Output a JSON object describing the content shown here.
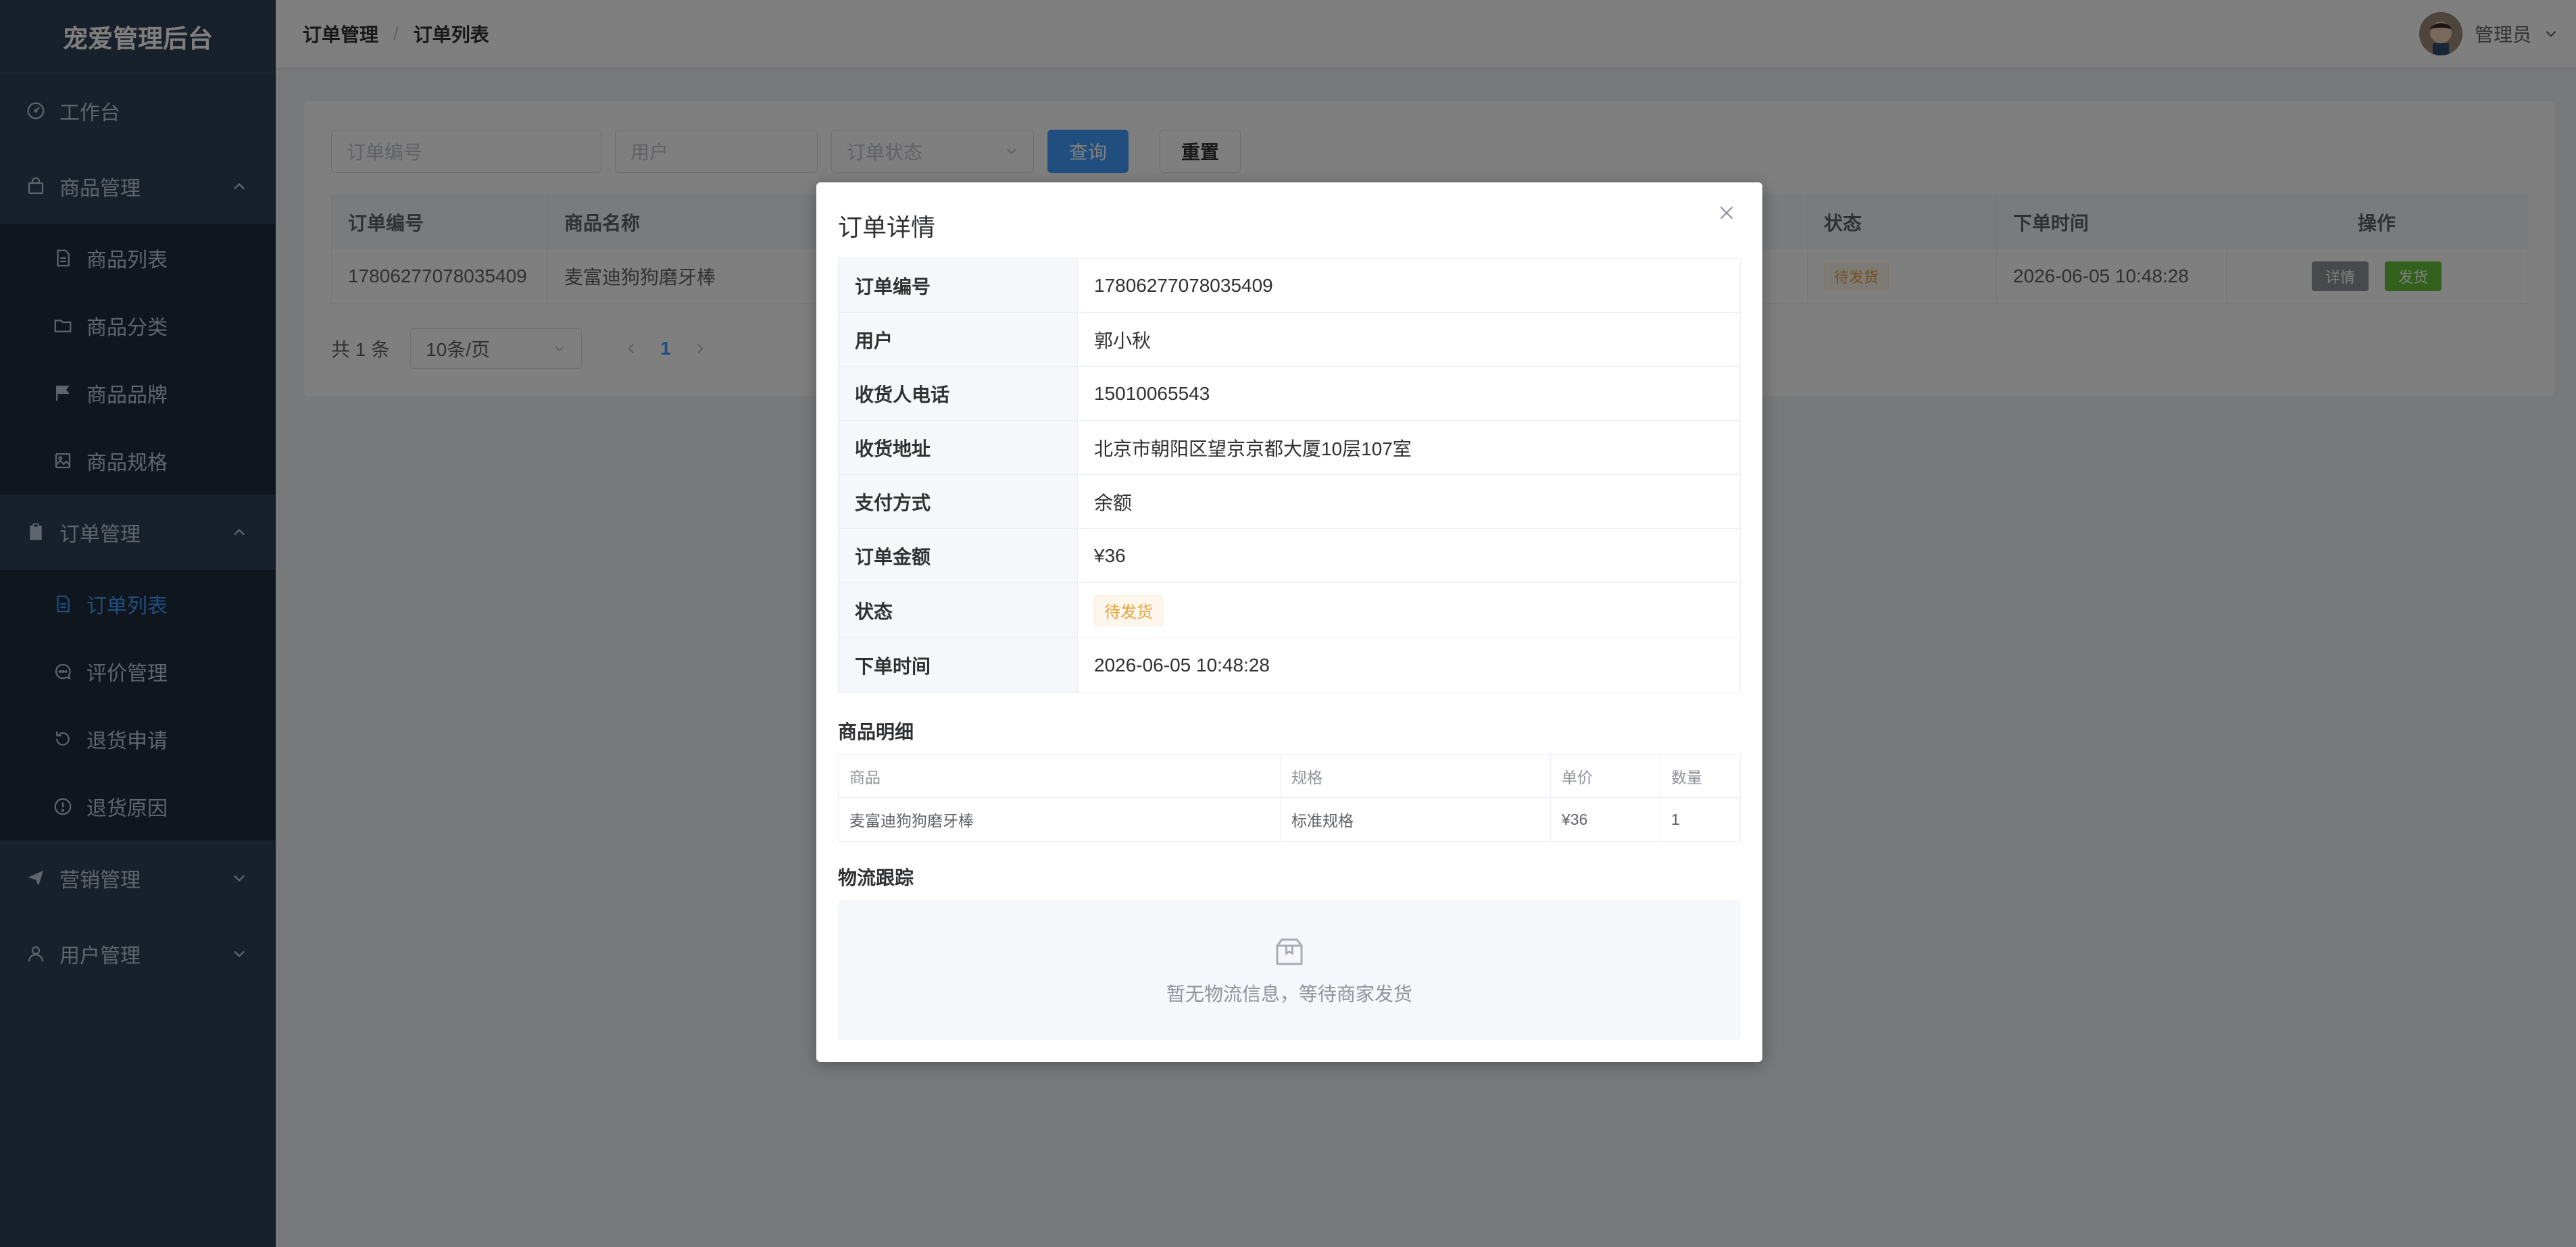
{
  "app": {
    "logo": "宠爱管理后台"
  },
  "sidebar": {
    "items": [
      {
        "label": "工作台",
        "icon": "gauge-icon"
      },
      {
        "label": "商品管理",
        "icon": "bag-icon"
      },
      {
        "label": "商品列表",
        "icon": "document-icon"
      },
      {
        "label": "商品分类",
        "icon": "folder-icon"
      },
      {
        "label": "商品品牌",
        "icon": "flag-icon"
      },
      {
        "label": "商品规格",
        "icon": "picture-icon"
      },
      {
        "label": "订单管理",
        "icon": "clipboard-icon"
      },
      {
        "label": "订单列表",
        "icon": "document-icon"
      },
      {
        "label": "评价管理",
        "icon": "chat-icon"
      },
      {
        "label": "退货申请",
        "icon": "refresh-icon"
      },
      {
        "label": "退货原因",
        "icon": "warning-icon"
      },
      {
        "label": "营销管理",
        "icon": "send-icon"
      },
      {
        "label": "用户管理",
        "icon": "user-icon"
      }
    ]
  },
  "header": {
    "breadcrumb": [
      "订单管理",
      "订单列表"
    ],
    "separator": "/",
    "user_name": "管理员"
  },
  "filters": {
    "order_no_placeholder": "订单编号",
    "user_placeholder": "用户",
    "status_placeholder": "订单状态",
    "query_label": "查询",
    "reset_label": "重置"
  },
  "table": {
    "headers": [
      "订单编号",
      "商品名称",
      "状态",
      "下单时间",
      "操作"
    ],
    "rows": [
      {
        "order_no": "17806277078035409",
        "product": "麦富迪狗狗磨牙棒",
        "status": "待发货",
        "time": "2026-06-05 10:48:28",
        "actions": [
          "详情",
          "发货"
        ]
      }
    ]
  },
  "pager": {
    "total": "共 1 条",
    "page_size": "10条/页",
    "current": "1"
  },
  "dialog": {
    "title": "订单详情",
    "fields": [
      {
        "label": "订单编号",
        "value": "17806277078035409"
      },
      {
        "label": "用户",
        "value": "郭小秋"
      },
      {
        "label": "收货人电话",
        "value": "15010065543"
      },
      {
        "label": "收货地址",
        "value": "北京市朝阳区望京京都大厦10层107室"
      },
      {
        "label": "支付方式",
        "value": "余额"
      },
      {
        "label": "订单金额",
        "value": "¥36"
      },
      {
        "label": "状态",
        "value": "待发货"
      },
      {
        "label": "下单时间",
        "value": "2026-06-05 10:48:28"
      }
    ],
    "items_title": "商品明细",
    "items_headers": [
      "商品",
      "规格",
      "单价",
      "数量"
    ],
    "items": [
      {
        "name": "麦富迪狗狗磨牙棒",
        "spec": "标准规格",
        "price": "¥36",
        "qty": "1"
      }
    ],
    "logistics_title": "物流跟踪",
    "logistics_empty": "暂无物流信息，等待商家发货"
  },
  "colors": {
    "sidebar_bg": "#304156",
    "primary": "#409eff",
    "warning": "#e6a23c",
    "success": "#67c23a",
    "info": "#909399"
  }
}
